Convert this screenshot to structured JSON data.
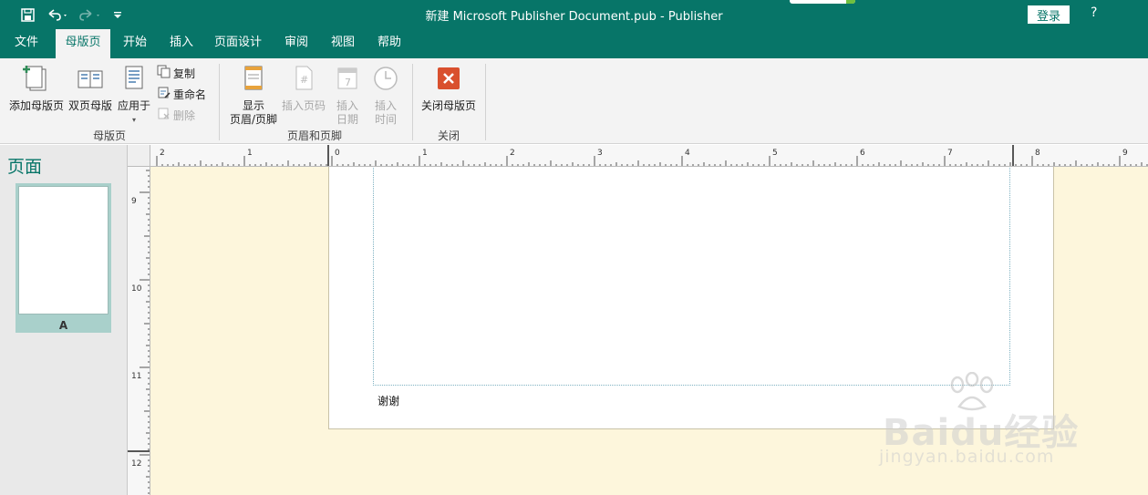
{
  "titlebar": {
    "title": "新建 Microsoft Publisher Document.pub  -  Publisher",
    "login": "登录",
    "help": "?"
  },
  "tabs": [
    {
      "label": "文件"
    },
    {
      "label": "母版页"
    },
    {
      "label": "开始"
    },
    {
      "label": "插入"
    },
    {
      "label": "页面设计"
    },
    {
      "label": "审阅"
    },
    {
      "label": "视图"
    },
    {
      "label": "帮助"
    }
  ],
  "ribbon": {
    "master": {
      "add_master": "添加母版页",
      "two_page": "双页母版",
      "apply_to": "应用于",
      "copy": "复制",
      "rename": "重命名",
      "delete": "删除",
      "group": "母版页"
    },
    "headerfooter": {
      "show_line1": "显示",
      "show_line2": "页眉/页脚",
      "page_number": "插入页码",
      "date_line1": "插入",
      "date_line2": "日期",
      "time_line1": "插入",
      "time_line2": "时间",
      "group": "页眉和页脚"
    },
    "close": {
      "close_master": "关闭母版页",
      "group": "关闭"
    }
  },
  "pages_panel": {
    "title": "页面",
    "thumb_label": "A"
  },
  "ruler": {
    "top_labels": [
      "2",
      "1",
      "0",
      "1",
      "2",
      "3",
      "4",
      "5",
      "6",
      "7",
      "8",
      "9"
    ],
    "left_labels": [
      "9",
      "10",
      "11",
      "12"
    ]
  },
  "document": {
    "footer_text": "谢谢"
  },
  "watermark": {
    "brand": "Baidu经验",
    "url": "jingyan.baidu.com"
  },
  "colors": {
    "brand": "#077568",
    "canvas": "#fdf6dc",
    "close_icon": "#d9502e"
  }
}
